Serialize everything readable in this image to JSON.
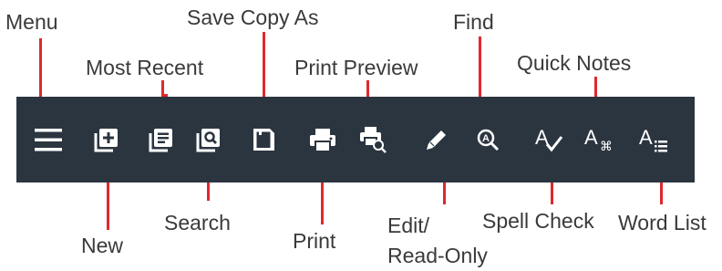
{
  "toolbar": {
    "background": "#2b3540",
    "icon_color": "#ffffff",
    "leader_color": "#e0282d",
    "items": [
      {
        "key": "menu",
        "label": "Menu",
        "icon": "hamburger-icon"
      },
      {
        "key": "new",
        "label": "New",
        "icon": "new-document-icon"
      },
      {
        "key": "most_recent",
        "label": "Most Recent",
        "icon": "recent-documents-icon"
      },
      {
        "key": "search",
        "label": "Search",
        "icon": "search-document-icon"
      },
      {
        "key": "save_copy_as",
        "label": "Save Copy As",
        "icon": "floppy-disk-icon"
      },
      {
        "key": "print",
        "label": "Print",
        "icon": "printer-icon"
      },
      {
        "key": "print_preview",
        "label": "Print Preview",
        "icon": "print-preview-icon"
      },
      {
        "key": "edit_read_only",
        "label": "Edit/ Read-Only",
        "label_lines": [
          "Edit/",
          "Read-Only"
        ],
        "icon": "pencil-icon"
      },
      {
        "key": "find",
        "label": "Find",
        "icon": "find-magnifier-icon"
      },
      {
        "key": "spell_check",
        "label": "Spell Check",
        "icon": "spell-check-icon"
      },
      {
        "key": "quick_notes",
        "label": "Quick Notes",
        "icon": "quick-notes-icon"
      },
      {
        "key": "word_list",
        "label": "Word List",
        "icon": "word-list-icon"
      }
    ]
  }
}
